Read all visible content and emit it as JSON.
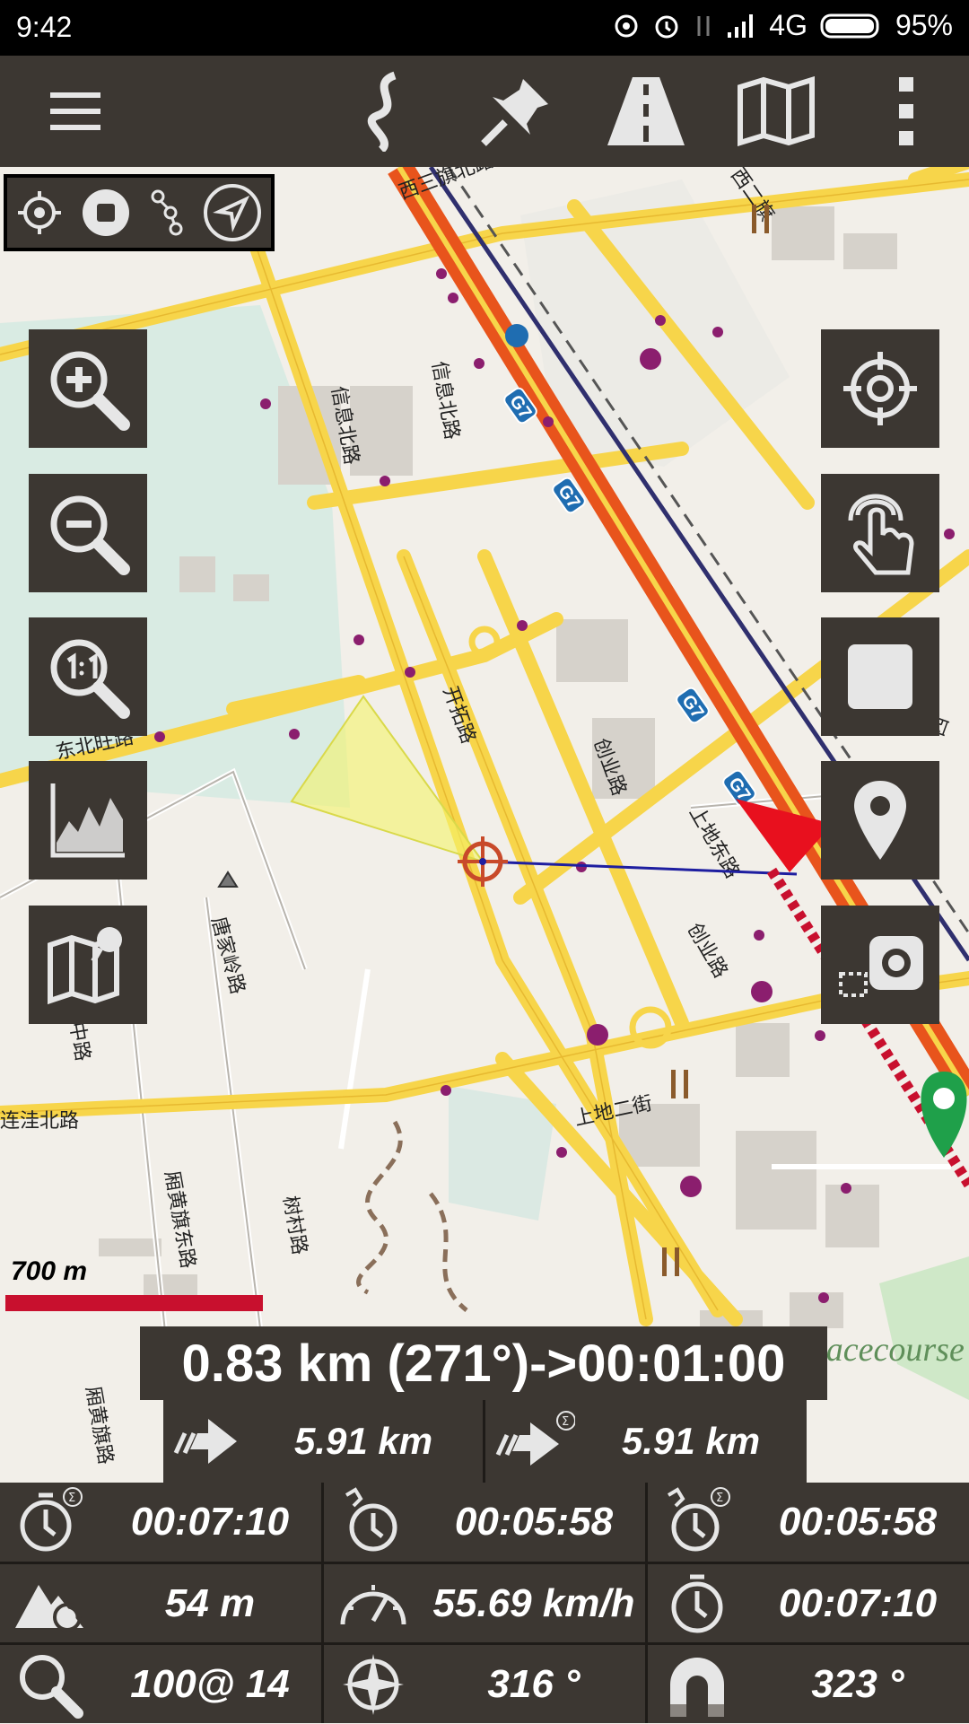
{
  "status_bar": {
    "time": "9:42",
    "network": "4G",
    "battery": "95%"
  },
  "map": {
    "road_labels": [
      "西三旗北路",
      "信息北路",
      "信息北路",
      "开拓路",
      "创业路",
      "创业路",
      "上地东路",
      "上地二街",
      "东北旺路",
      "唐家岭路",
      "中路",
      "连洼北路",
      "西",
      "厢黄旗东路",
      "树村路",
      "厢黄旗路",
      "西二旗",
      "racecourse"
    ],
    "highway_shield": "G7",
    "scale_label": "700 m"
  },
  "navigation": {
    "target_info": "0.83 km (271°)->00:01:00",
    "distance_remaining": "5.91 km",
    "distance_total": "5.91 km"
  },
  "stats": [
    {
      "icon": "stopwatch-sum-icon",
      "value": "00:07:10"
    },
    {
      "icon": "moving-time-icon",
      "value": "00:05:58"
    },
    {
      "icon": "moving-time-sum-icon",
      "value": "00:05:58"
    },
    {
      "icon": "altitude-icon",
      "value": "54 m"
    },
    {
      "icon": "speedometer-icon",
      "value": "55.69 km/h"
    },
    {
      "icon": "stopwatch-icon",
      "value": "00:07:10"
    },
    {
      "icon": "zoom-icon",
      "value": "100@ 14"
    },
    {
      "icon": "compass-icon",
      "value": "316 °"
    },
    {
      "icon": "magnet-icon",
      "value": "323 °"
    }
  ],
  "colors": {
    "panel": "#3c3732",
    "highway": "#e8541c",
    "road": "#f7d54a",
    "track": "#c8102e",
    "poi": "#8b1e6e"
  }
}
